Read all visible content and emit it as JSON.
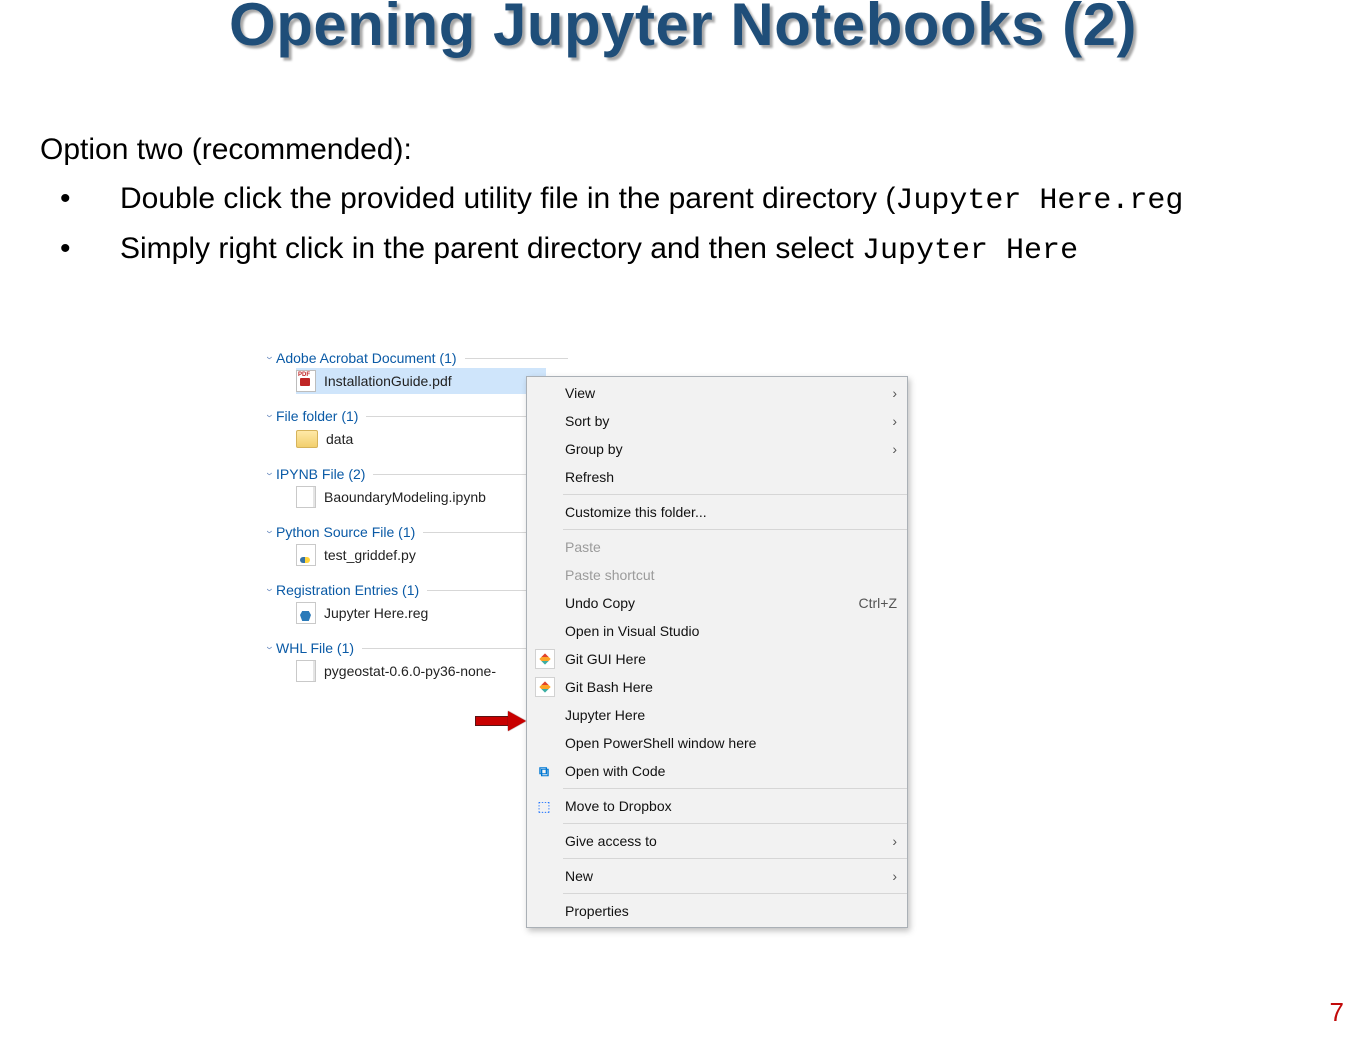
{
  "slide": {
    "title": "Opening Jupyter Notebooks (2)",
    "page_number": "7",
    "bullets": {
      "option_label": "Option two (recommended):",
      "sub1_pre": "Double click the provided utility file in the parent directory (",
      "sub1_code": "Jupyter Here.reg",
      "sub2_pre": "Simply right click in the parent directory and then select ",
      "sub2_code": "Jupyter Here"
    }
  },
  "explorer": {
    "groups": [
      {
        "header": "Adobe Acrobat Document (1)",
        "file": "InstallationGuide.pdf",
        "icon": "pdf",
        "selected": true
      },
      {
        "header": "File folder (1)",
        "file": "data",
        "icon": "folder",
        "selected": false
      },
      {
        "header": "IPYNB File (2)",
        "file": "BaoundaryModeling.ipynb",
        "icon": "blank",
        "selected": false
      },
      {
        "header": "Python Source File (1)",
        "file": "test_griddef.py",
        "icon": "py",
        "selected": false
      },
      {
        "header": "Registration Entries (1)",
        "file": "Jupyter Here.reg",
        "icon": "reg",
        "selected": false
      },
      {
        "header": "WHL File (1)",
        "file": "pygeostat-0.6.0-py36-none-",
        "icon": "blank",
        "selected": false
      }
    ]
  },
  "context_menu": {
    "items": [
      {
        "label": "View",
        "submenu": true
      },
      {
        "label": "Sort by",
        "submenu": true
      },
      {
        "label": "Group by",
        "submenu": true
      },
      {
        "label": "Refresh"
      },
      {
        "sep": true
      },
      {
        "label": "Customize this folder..."
      },
      {
        "sep": true
      },
      {
        "label": "Paste",
        "disabled": true
      },
      {
        "label": "Paste shortcut",
        "disabled": true
      },
      {
        "label": "Undo Copy",
        "shortcut": "Ctrl+Z"
      },
      {
        "label": "Open in Visual Studio"
      },
      {
        "label": "Git GUI Here",
        "icon": "git"
      },
      {
        "label": "Git Bash Here",
        "icon": "git"
      },
      {
        "label": "Jupyter Here",
        "target": true
      },
      {
        "label": "Open PowerShell window here"
      },
      {
        "label": "Open with Code",
        "icon": "vscode"
      },
      {
        "sep": true
      },
      {
        "label": "Move to Dropbox",
        "icon": "dropbox"
      },
      {
        "sep": true
      },
      {
        "label": "Give access to",
        "submenu": true
      },
      {
        "sep": true
      },
      {
        "label": "New",
        "submenu": true
      },
      {
        "sep": true
      },
      {
        "label": "Properties"
      }
    ]
  }
}
